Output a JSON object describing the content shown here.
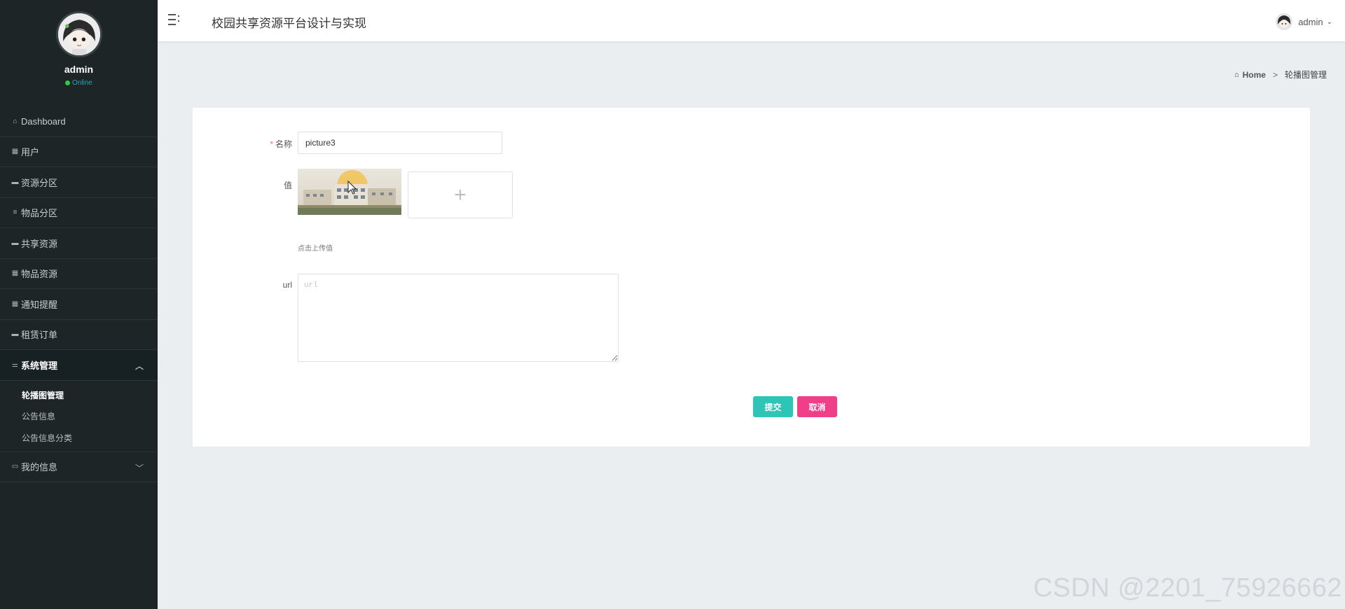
{
  "app": {
    "title": "校园共享资源平台设计与实现"
  },
  "profile": {
    "name": "admin",
    "status": "Online"
  },
  "sidebar": {
    "items": [
      {
        "label": "Dashboard",
        "icon": "home-icon"
      },
      {
        "label": "用户",
        "icon": "grid-icon"
      },
      {
        "label": "资源分区",
        "icon": "comment-icon"
      },
      {
        "label": "物品分区",
        "icon": "list-icon"
      },
      {
        "label": "共享资源",
        "icon": "comment-icon"
      },
      {
        "label": "物品资源",
        "icon": "grid-icon"
      },
      {
        "label": "通知提醒",
        "icon": "grid-icon"
      },
      {
        "label": "租赁订单",
        "icon": "comment-icon"
      },
      {
        "label": "系统管理",
        "icon": "sliders-icon",
        "expanded": true
      },
      {
        "label": "我的信息",
        "icon": "card-icon",
        "expanded": false
      }
    ],
    "system_sub": [
      {
        "label": "轮播图管理",
        "active": true
      },
      {
        "label": "公告信息"
      },
      {
        "label": "公告信息分类"
      }
    ]
  },
  "header": {
    "user": "admin"
  },
  "breadcrumb": {
    "home": "Home",
    "separator": ">",
    "current": "轮播图管理"
  },
  "form": {
    "name_label": "名称",
    "name_required": "*",
    "name_value": "picture3",
    "value_label": "值",
    "upload_tip": "点击上传值",
    "upload_plus": "+",
    "url_label": "url",
    "url_placeholder": "url",
    "submit_label": "提交",
    "cancel_label": "取消"
  },
  "colors": {
    "sidebar_bg": "#1e2527",
    "submit": "#2ec4b6",
    "cancel": "#ef3f88",
    "status": "#28a7b6"
  },
  "watermark": "CSDN @2201_75926662"
}
